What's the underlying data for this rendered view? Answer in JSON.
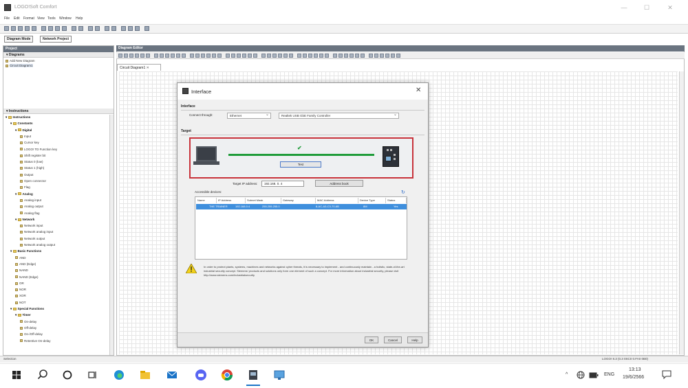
{
  "window": {
    "title": "LOGO!Soft Comfort",
    "minimize": "—",
    "maximize": "☐",
    "close": "✕"
  },
  "menu": [
    "File",
    "Edit",
    "Format",
    "View",
    "Tools",
    "Window",
    "Help"
  ],
  "mode_tabs": [
    "Diagram Mode",
    "Network Project"
  ],
  "left_panel": {
    "header": "Project",
    "diagrams_label": "Diagrams",
    "diagram_items": [
      "Add New Diagram",
      "Circuit Diagram1"
    ],
    "instructions_label": "Instructions",
    "tree": [
      {
        "label": "Instructions",
        "level": 0,
        "bold": true,
        "type": "folder"
      },
      {
        "label": "Constants",
        "level": 1,
        "bold": true,
        "type": "folder"
      },
      {
        "label": "Digital",
        "level": 2,
        "bold": true,
        "type": "folder"
      },
      {
        "label": "Input",
        "level": 3,
        "type": "leaf"
      },
      {
        "label": "Cursor key",
        "level": 3,
        "type": "leaf"
      },
      {
        "label": "LOGO! TD Function key",
        "level": 3,
        "type": "leaf"
      },
      {
        "label": "Shift register bit",
        "level": 3,
        "type": "leaf"
      },
      {
        "label": "Status 0 (low)",
        "level": 3,
        "type": "leaf"
      },
      {
        "label": "Status 1 (high)",
        "level": 3,
        "type": "leaf"
      },
      {
        "label": "Output",
        "level": 3,
        "type": "leaf"
      },
      {
        "label": "Open connector",
        "level": 3,
        "type": "leaf"
      },
      {
        "label": "Flag",
        "level": 3,
        "type": "leaf"
      },
      {
        "label": "Analog",
        "level": 2,
        "bold": true,
        "type": "folder"
      },
      {
        "label": "Analog input",
        "level": 3,
        "type": "leaf"
      },
      {
        "label": "Analog output",
        "level": 3,
        "type": "leaf"
      },
      {
        "label": "Analog flag",
        "level": 3,
        "type": "leaf"
      },
      {
        "label": "Network",
        "level": 2,
        "bold": true,
        "type": "folder"
      },
      {
        "label": "Network input",
        "level": 3,
        "type": "leaf"
      },
      {
        "label": "Network analog input",
        "level": 3,
        "type": "leaf"
      },
      {
        "label": "Network output",
        "level": 3,
        "type": "leaf"
      },
      {
        "label": "Network analog output",
        "level": 3,
        "type": "leaf"
      },
      {
        "label": "Basic Functions",
        "level": 1,
        "bold": true,
        "type": "folder"
      },
      {
        "label": "AND",
        "level": 2,
        "type": "leaf"
      },
      {
        "label": "AND (Edge)",
        "level": 2,
        "type": "leaf"
      },
      {
        "label": "NAND",
        "level": 2,
        "type": "leaf"
      },
      {
        "label": "NAND (Edge)",
        "level": 2,
        "type": "leaf"
      },
      {
        "label": "OR",
        "level": 2,
        "type": "leaf"
      },
      {
        "label": "NOR",
        "level": 2,
        "type": "leaf"
      },
      {
        "label": "XOR",
        "level": 2,
        "type": "leaf"
      },
      {
        "label": "NOT",
        "level": 2,
        "type": "leaf"
      },
      {
        "label": "Special Functions",
        "level": 1,
        "bold": true,
        "type": "folder"
      },
      {
        "label": "Timer",
        "level": 2,
        "bold": true,
        "type": "folder"
      },
      {
        "label": "On-delay",
        "level": 3,
        "type": "leaf"
      },
      {
        "label": "Off-delay",
        "level": 3,
        "type": "leaf"
      },
      {
        "label": "On-/Off-delay",
        "level": 3,
        "type": "leaf"
      },
      {
        "label": "Retentive On-delay",
        "level": 3,
        "type": "leaf"
      }
    ]
  },
  "editor": {
    "header": "Diagram Editor",
    "doc_tab": "Circuit Diagram1"
  },
  "dialog": {
    "title": "Interface",
    "interface_label": "Interface",
    "connect_through_label": "Connect through:",
    "connect_through_value": "Ethernet",
    "adapter_value": "Realtek USB GbE Family Controller",
    "target_label": "Target",
    "test_button": "Test",
    "target_ip_label": "Target IP address:",
    "target_ip_value": "192.168. 0. 4",
    "address_book_button": "Address book",
    "accessible_devices_label": "Accessible devices:",
    "table_headers": [
      "Name",
      "IP Address",
      "Subnet Mask",
      "Gateway",
      "MAC Address",
      "Device Type",
      "Status"
    ],
    "table_row": [
      "THE TRAINER",
      "192.168.0.4",
      "255.255.255.0",
      "",
      "8-AC-A3-C3-70-6B",
      "8M",
      "Yes"
    ],
    "warning_text": "In order to protect plants, systems, machines and networks against cyber threats, it is necessary to implement - and continuously maintain - a holistic, state-of-the-art industrial security concept. Siemens' products and solutions only form one element of such a concept. For more information about industrial security, please visit http://www.siemens.com/industrialsecurity",
    "ok_button": "OK",
    "cancel_button": "Cancel",
    "help_button": "Help",
    "connection_ok_icon": "✔"
  },
  "status": {
    "left": "Selection",
    "right": "LOGO! 8.3 (0.3 0SC0 0.FA0 0B0)"
  },
  "taskbar": {
    "lang": "ENG",
    "time": "13:13",
    "date": "19/6/2566",
    "chevron": "^"
  },
  "colors": {
    "highlight_border": "#c8323a",
    "link_green": "#1f9c3a",
    "selection_blue": "#3f8fdd"
  }
}
